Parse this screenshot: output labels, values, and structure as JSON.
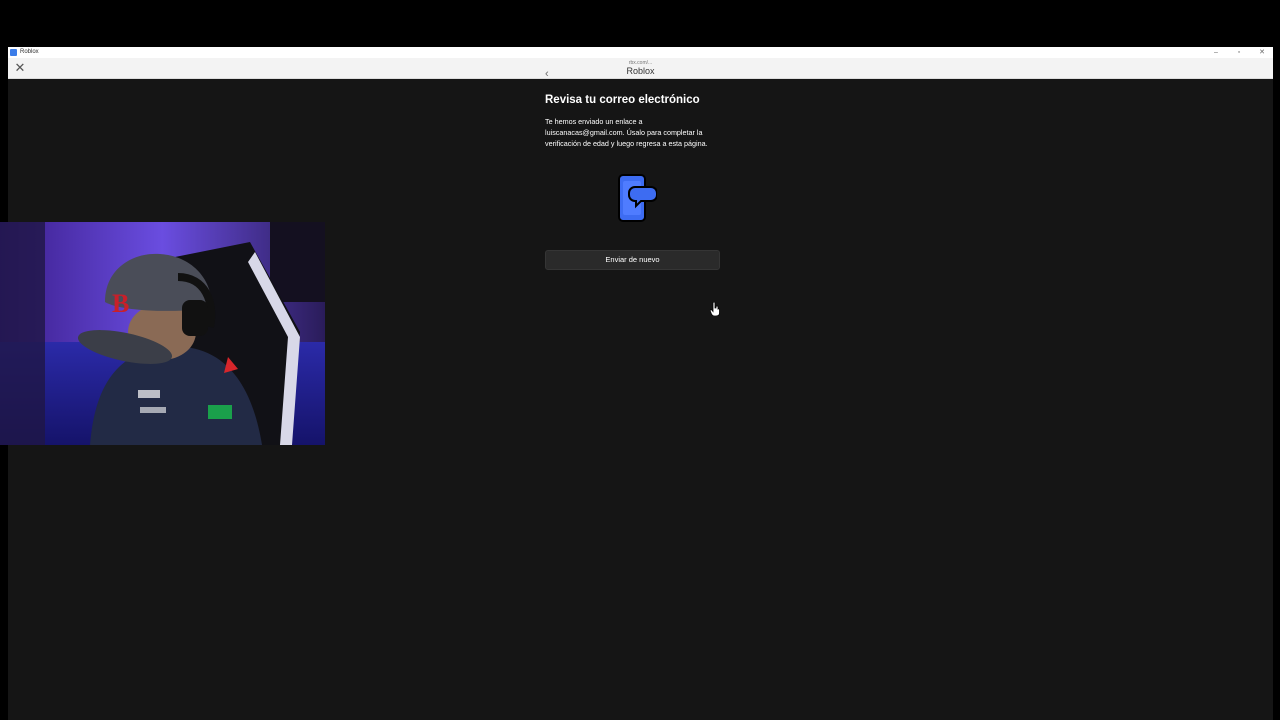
{
  "window": {
    "os_title": "Roblox",
    "controls": {
      "minimize": "–",
      "maximize": "▫",
      "close": "✕"
    }
  },
  "header": {
    "close_glyph": "✕",
    "url": "rbx.com/...",
    "title": "Roblox"
  },
  "content": {
    "back_glyph": "‹",
    "heading": "Revisa tu correo electrónico",
    "body": "Te hemos enviado un enlace a luiscanacas@gmail.com. Úsalo para completar la verificación de edad y luego regresa a esta página.",
    "resend_label": "Enviar de nuevo"
  },
  "icons": {
    "back": "chevron-left-icon",
    "illustration": "phone-message-icon",
    "cursor": "hand-pointer-icon"
  },
  "colors": {
    "window_background": "#151515",
    "accent_blue": "#3d6cf2",
    "button_background": "#2a2a2a",
    "text": "#ffffff"
  }
}
